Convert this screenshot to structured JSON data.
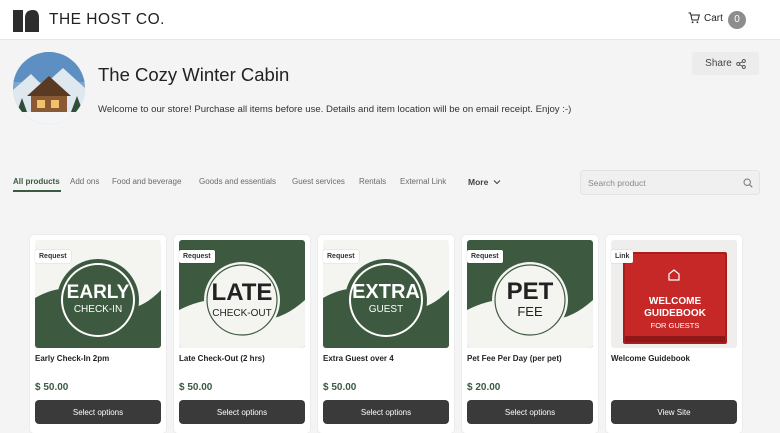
{
  "header": {
    "brand": "THE HOST CO.",
    "cart_label": "Cart",
    "cart_count": "0"
  },
  "store": {
    "title": "The Cozy Winter Cabin",
    "description": "Welcome to our store! Purchase all items before use. Details and item location will be on email receipt. Enjoy :-)",
    "share_label": "Share"
  },
  "tabs": [
    {
      "label": "All products",
      "active": true
    },
    {
      "label": "Add ons"
    },
    {
      "label": "Food and beverage"
    },
    {
      "label": "Goods and essentials"
    },
    {
      "label": "Guest services"
    },
    {
      "label": "Rentals"
    },
    {
      "label": "External Link"
    }
  ],
  "more_label": "More",
  "search": {
    "placeholder": "Search product",
    "value": ""
  },
  "products": [
    {
      "badge": "Request",
      "name": "Early Check-In 2pm",
      "price": "$ 50.00",
      "button": "Select options",
      "sign_top": "EARLY",
      "sign_bottom": "CHECK-IN"
    },
    {
      "badge": "Request",
      "name": "Late Check-Out (2 hrs)",
      "price": "$ 50.00",
      "button": "Select options",
      "sign_top": "LATE",
      "sign_bottom": "CHECK-OUT"
    },
    {
      "badge": "Request",
      "name": "Extra Guest over 4",
      "price": "$ 50.00",
      "button": "Select options",
      "sign_top": "EXTRA",
      "sign_bottom": "GUEST"
    },
    {
      "badge": "Request",
      "name": "Pet Fee Per Day (per pet)",
      "price": "$ 20.00",
      "button": "Select options",
      "sign_top": "PET",
      "sign_bottom": "FEE"
    },
    {
      "badge": "Link",
      "name": "Welcome Guidebook",
      "price": "",
      "button": "View Site",
      "book_line1": "WELCOME",
      "book_line2": "GUIDEBOOK",
      "book_line3": "FOR GUESTS"
    }
  ],
  "colors": {
    "accent": "#3b5a44",
    "button": "#3a3a3a",
    "book_red": "#c62828"
  }
}
